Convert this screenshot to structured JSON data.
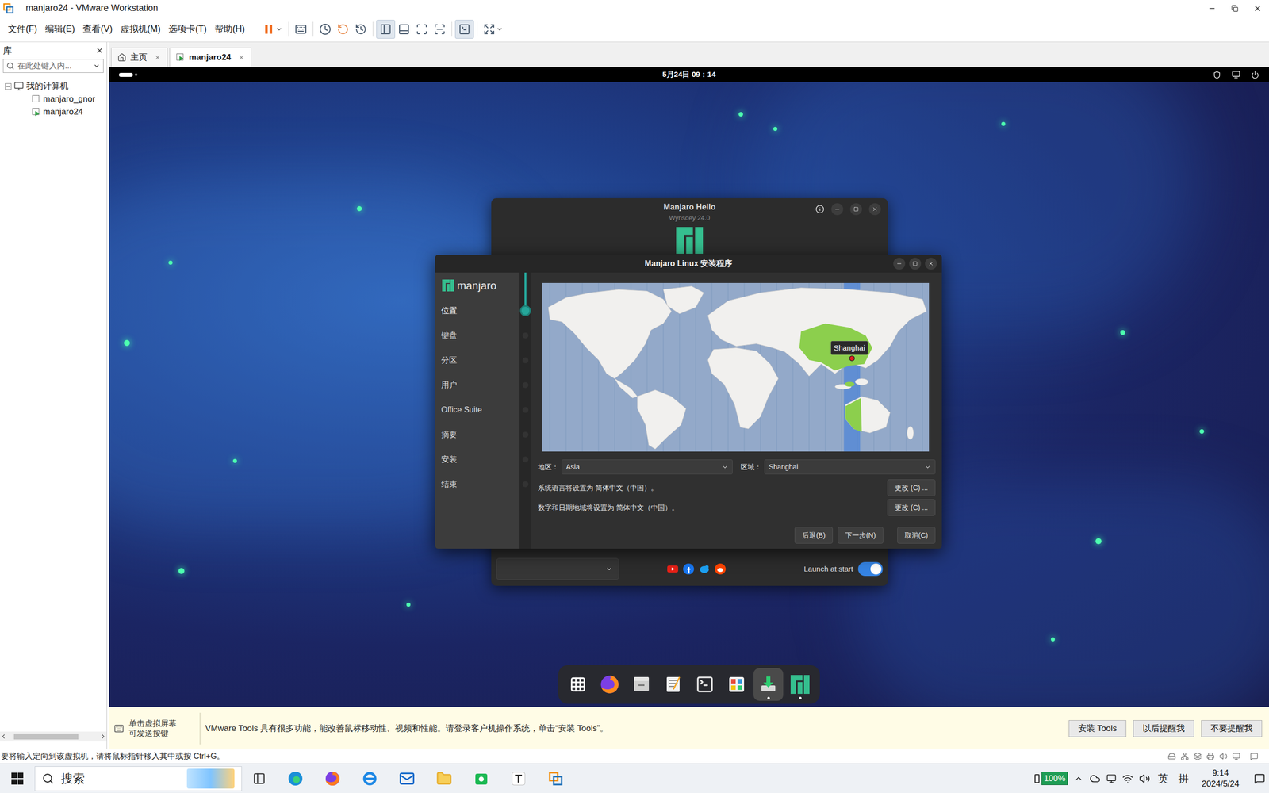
{
  "window": {
    "title": "manjaro24 - VMware Workstation"
  },
  "menu": [
    "文件(F)",
    "编辑(E)",
    "查看(V)",
    "虚拟机(M)",
    "选项卡(T)",
    "帮助(H)"
  ],
  "library": {
    "title": "库",
    "search": {
      "placeholder": "在此处键入内..."
    },
    "tree": [
      {
        "label": "我的计算机",
        "depth": 0,
        "expanded": true,
        "running": false
      },
      {
        "label": "manjaro_gnor",
        "depth": 1,
        "expanded": false,
        "running": false
      },
      {
        "label": "manjaro24",
        "depth": 1,
        "expanded": false,
        "running": true
      }
    ]
  },
  "tabs": [
    {
      "label": "主页",
      "selected": false
    },
    {
      "label": "manjaro24",
      "selected": true
    }
  ],
  "guest": {
    "top_bar": {
      "clock": "5月24日 09：14"
    },
    "hello": {
      "title": "Manjaro Hello",
      "subtitle": "Wynsdey 24.0",
      "launch_at_start": {
        "label": "Launch at start",
        "on": true
      }
    },
    "installer": {
      "title": "Manjaro Linux 安装程序",
      "logo": "manjaro",
      "steps": [
        {
          "label": "位置",
          "selected": true
        },
        {
          "label": "键盘",
          "selected": false
        },
        {
          "label": "分区",
          "selected": false
        },
        {
          "label": "用户",
          "selected": false
        },
        {
          "label": "Office Suite",
          "selected": false
        },
        {
          "label": "摘要",
          "selected": false
        },
        {
          "label": "安装",
          "selected": false
        },
        {
          "label": "结束",
          "selected": false
        }
      ],
      "map": {
        "tooltip": "Shanghai"
      },
      "region": {
        "label": "地区：",
        "value": "Asia"
      },
      "zone": {
        "label": "区域：",
        "value": "Shanghai"
      },
      "locale_lines": [
        {
          "text": "系统语言将设置为 简体中文（中国）。",
          "button": "更改 (C) ..."
        },
        {
          "text": "数字和日期地域将设置为 简体中文（中国）。",
          "button": "更改 (C) ..."
        }
      ],
      "buttons": [
        "后退(B)",
        "下一步(N)",
        "取消(C)"
      ]
    },
    "dock": [
      {
        "running": false,
        "focused": false
      },
      {
        "running": false,
        "focused": false
      },
      {
        "running": false,
        "focused": false
      },
      {
        "running": false,
        "focused": false
      },
      {
        "running": false,
        "focused": false
      },
      {
        "running": false,
        "focused": false
      },
      {
        "running": true,
        "focused": true
      },
      {
        "running": true,
        "focused": false
      }
    ]
  },
  "tools_bar": {
    "hint": [
      "单击虚拟屏幕",
      "可发送按键"
    ],
    "message": "VMware Tools 具有很多功能，能改善鼠标移动性、视频和性能。请登录客户机操作系统，单击“安装 Tools”。",
    "buttons": [
      "安装 Tools",
      "以后提醒我",
      "不要提醒我"
    ]
  },
  "status_bar": {
    "text": "要将输入定向到该虚拟机，请将鼠标指针移入其中或按 Ctrl+G。"
  },
  "taskbar": {
    "search": {
      "placeholder": "搜索"
    },
    "battery": "100%",
    "ime": [
      "英",
      "拼"
    ],
    "time": "9:14",
    "date": "2024/5/24"
  }
}
